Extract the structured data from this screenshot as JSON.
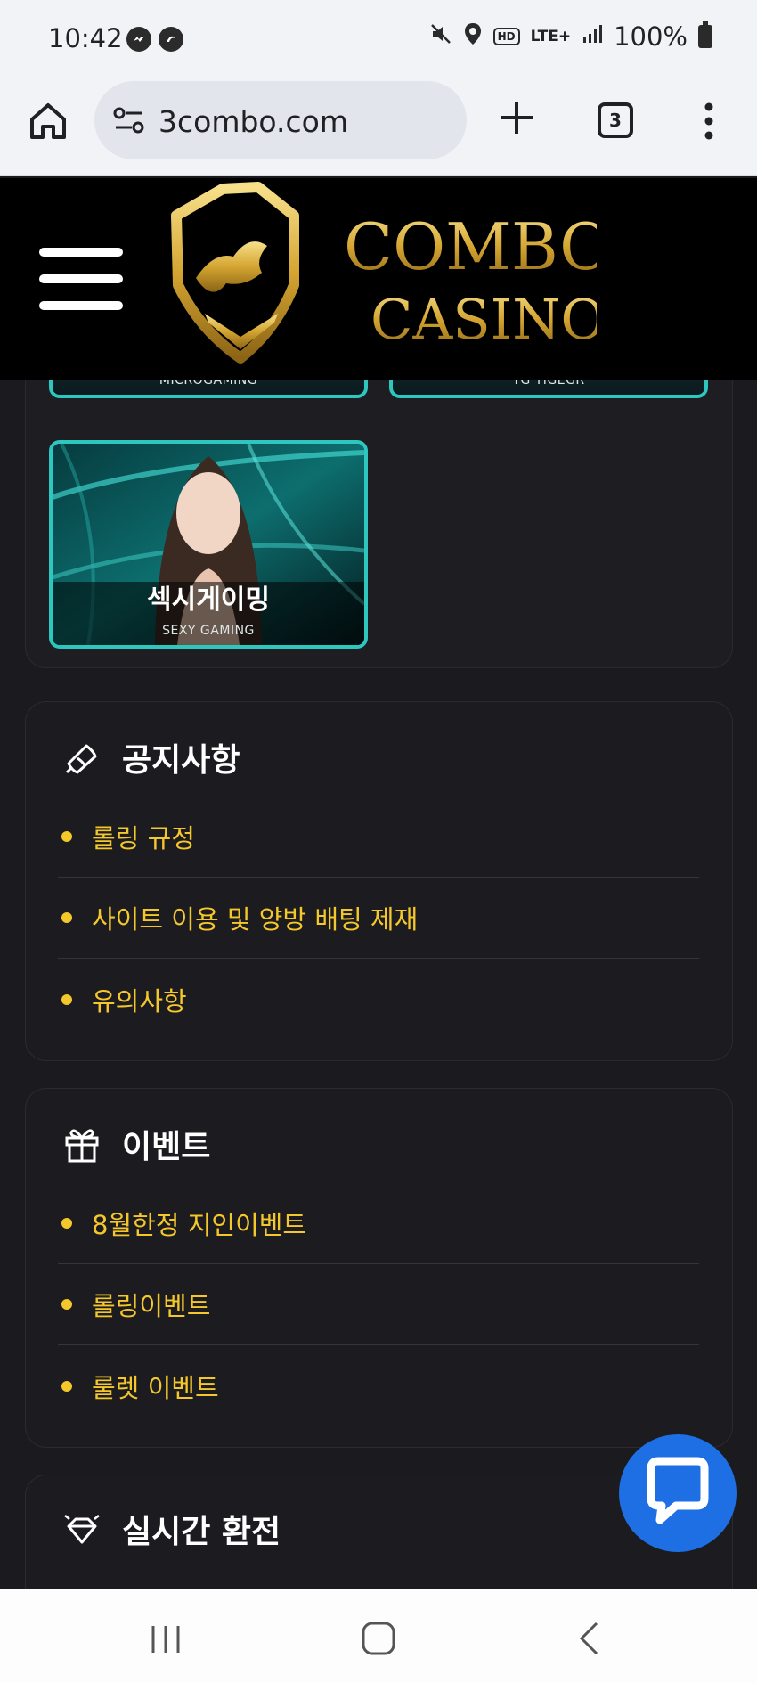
{
  "status_bar": {
    "time": "10:42",
    "network": "LTE+",
    "battery": "100%"
  },
  "browser": {
    "url": "3combo.com",
    "tab_count": "3"
  },
  "site": {
    "logo_line1": "COMBO",
    "logo_line2": "CASINO"
  },
  "games": [
    {
      "provider": "MICROGAMING"
    },
    {
      "provider": "TG TIGEGR"
    },
    {
      "title_ko": "섹시게이밍",
      "provider": "SEXY GAMING"
    }
  ],
  "notice": {
    "title": "공지사항",
    "items": [
      "롤링 규정",
      "사이트 이용 및 양방 배팅 제재",
      "유의사항"
    ]
  },
  "event": {
    "title": "이벤트",
    "items": [
      "8월한정 지인이벤트",
      "롤링이벤트",
      "룰렛 이벤트"
    ]
  },
  "exchange": {
    "title": "실시간 환전"
  },
  "colors": {
    "accent_gold": "#f4c72a",
    "card_border": "#2dc7c0",
    "chat_blue": "#1d6fe3"
  }
}
